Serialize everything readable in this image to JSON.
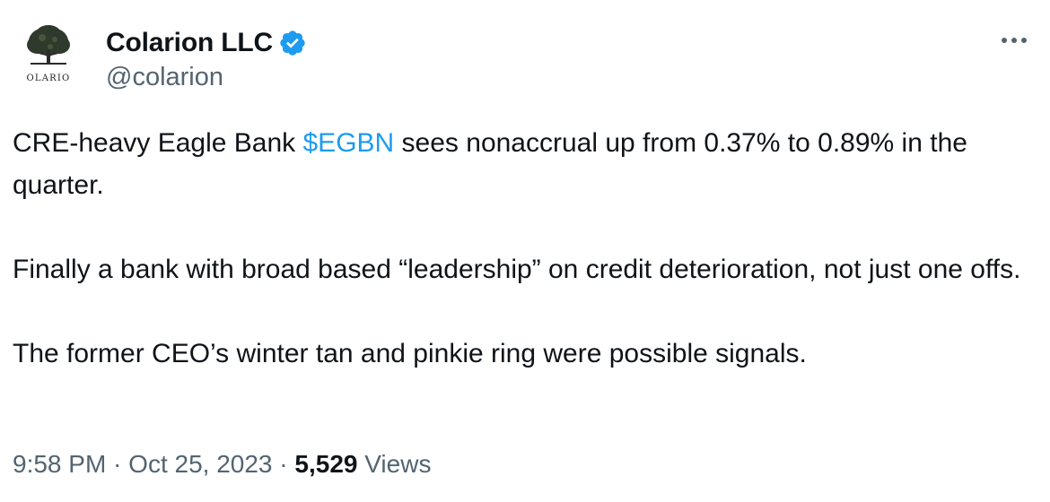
{
  "author": {
    "display_name": "Colarion LLC",
    "handle": "@colarion",
    "avatar_text": "OLARIO",
    "verified_icon": "verified-badge-icon",
    "verified_color": "#1d9bf0"
  },
  "more_icon": "more-horizontal-icon",
  "tweet": {
    "p1_before": "CRE-heavy Eagle Bank ",
    "cashtag": "$EGBN",
    "p1_after": " sees nonaccrual up from 0.37% to 0.89% in the quarter.",
    "p2": "Finally a bank with broad based “leadership” on credit deterioration, not just one offs.",
    "p3": "The former CEO’s winter tan and pinkie ring were possible signals."
  },
  "meta": {
    "time": "9:58 PM",
    "separator": " · ",
    "date": "Oct 25, 2023",
    "views_count": "5,529",
    "views_label": " Views"
  },
  "colors": {
    "text": "#0f1419",
    "secondary": "#536471",
    "link": "#1d9bf0"
  }
}
